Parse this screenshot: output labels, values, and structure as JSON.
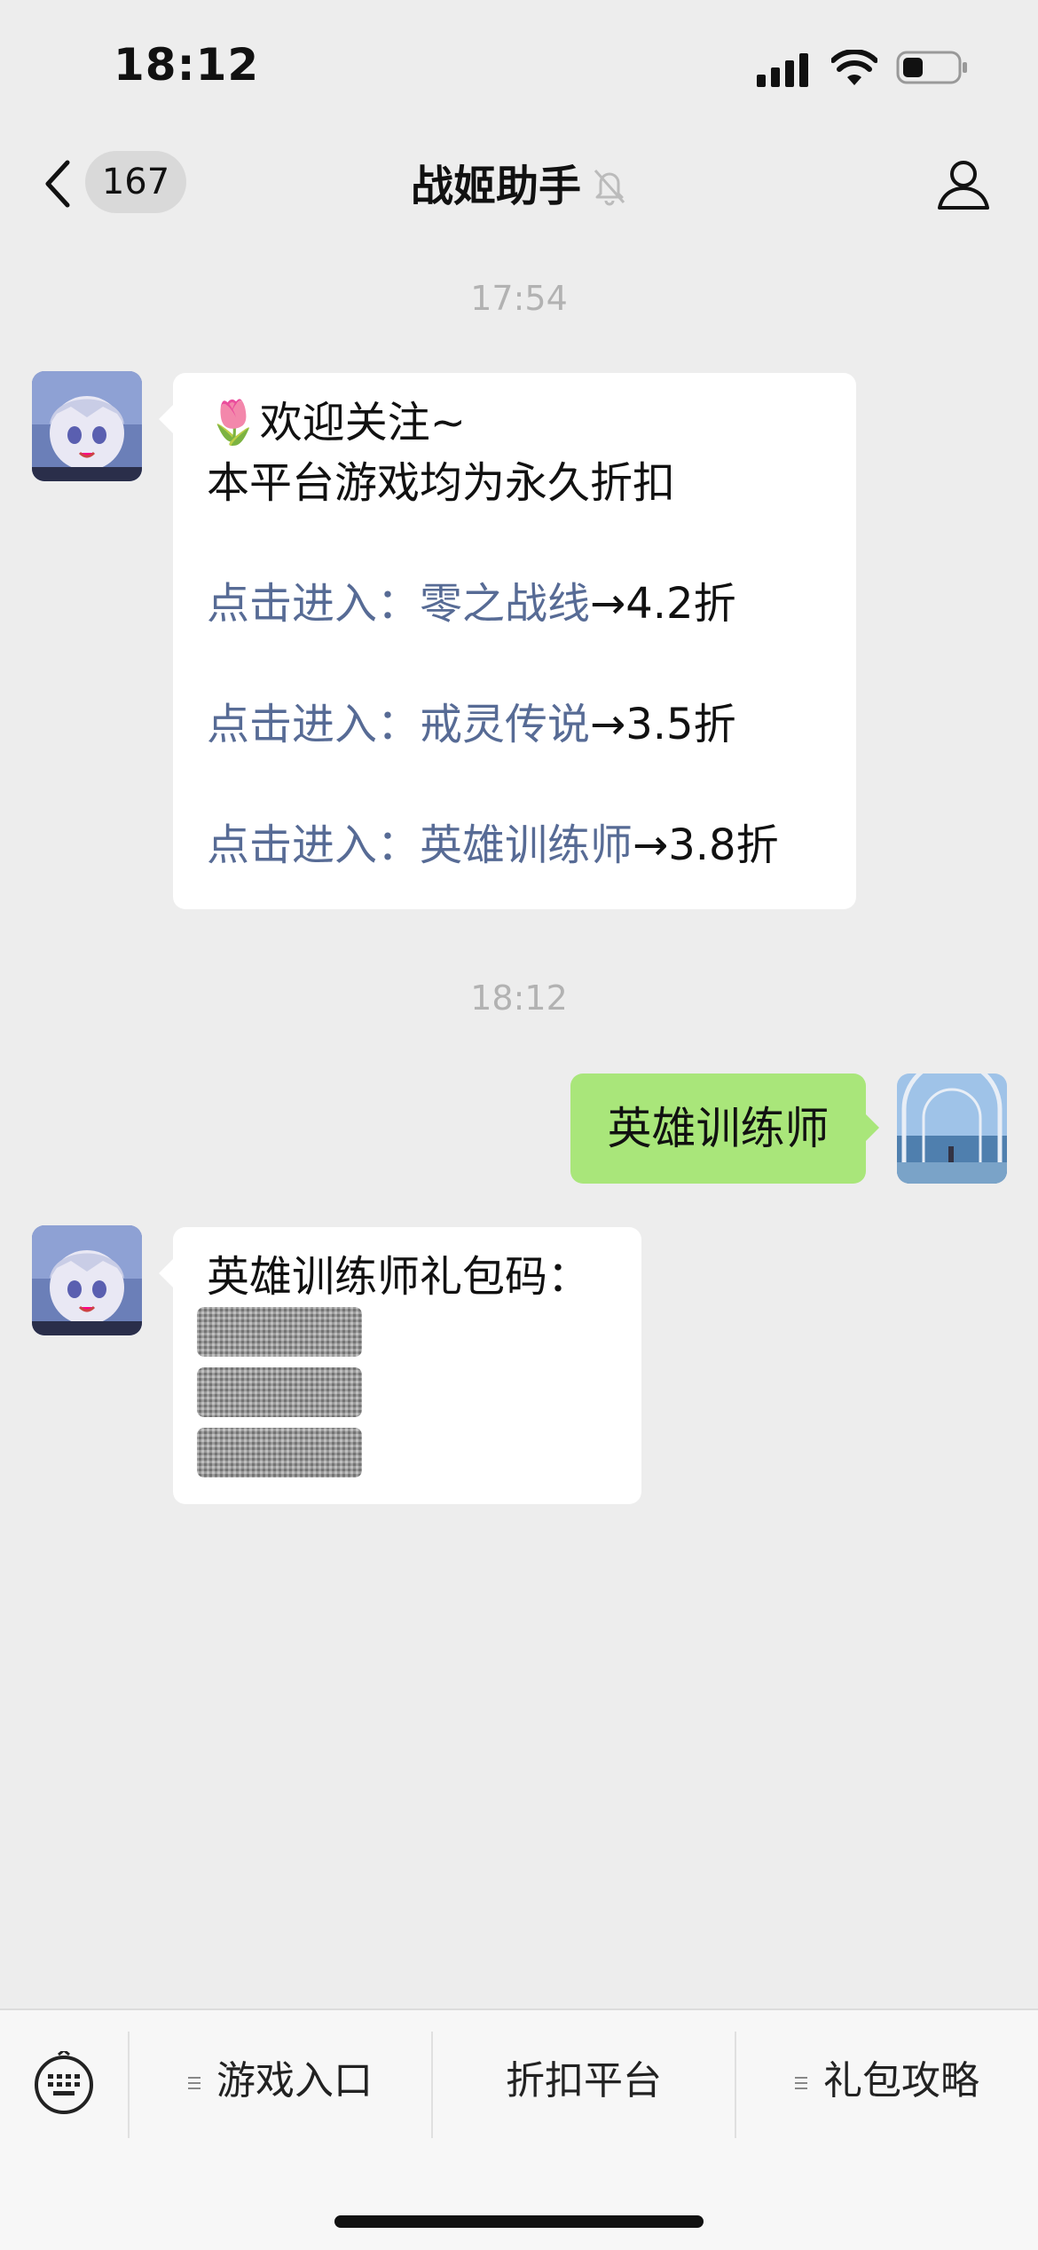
{
  "status_bar": {
    "time": "18:12"
  },
  "nav": {
    "unread_count": "167",
    "title": "战姬助手"
  },
  "chat": {
    "time_1": "17:54",
    "welcome": {
      "line_1": "🌷欢迎关注~",
      "line_2": "本平台游戏均为永久折扣",
      "links": [
        {
          "prefix": "点击进入：",
          "game": "零之战线",
          "discount": "→4.2折"
        },
        {
          "prefix": "点击进入：",
          "game": "戒灵传说",
          "discount": "→3.5折"
        },
        {
          "prefix": "点击进入：",
          "game": "英雄训练师",
          "discount": "→3.8折"
        }
      ]
    },
    "time_2": "18:12",
    "sent_message": "英雄训练师",
    "reply": {
      "text": "英雄训练师礼包码："
    }
  },
  "menu": {
    "items": [
      {
        "label": "游戏入口"
      },
      {
        "label": "折扣平台"
      },
      {
        "label": "礼包攻略"
      }
    ]
  },
  "colors": {
    "link": "#576b95",
    "sent_bubble": "#a9e67a",
    "background": "#ededed"
  }
}
